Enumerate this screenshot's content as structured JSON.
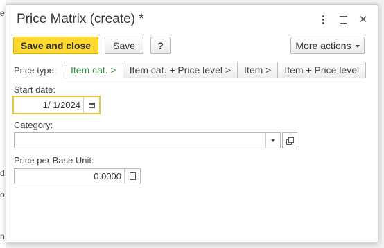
{
  "background": {
    "edge_chars": [
      "e",
      "d",
      "o",
      "n"
    ]
  },
  "dialog": {
    "title": "Price Matrix (create) *",
    "icons": {
      "menu": "kebab-menu-icon",
      "maximize": "maximize-icon",
      "close": "close-icon"
    },
    "close_glyph": "✕"
  },
  "toolbar": {
    "save_close_label": "Save and close",
    "save_label": "Save",
    "help_label": "?",
    "more_actions_label": "More actions"
  },
  "price_type": {
    "label": "Price type:",
    "options": [
      "Item cat. >",
      "Item cat. + Price level >",
      "Item >",
      "Item + Price level"
    ],
    "selected": "Item cat. >"
  },
  "start_date": {
    "label": "Start date:",
    "value": "1/ 1/2024"
  },
  "category": {
    "label": "Category:",
    "value": ""
  },
  "price_per_base_unit": {
    "label": "Price per Base Unit:",
    "value": "0.0000"
  },
  "colors": {
    "primary": "#ffd92f",
    "selected_text": "#2f8c3f",
    "focus_border": "#f0c23a",
    "required_underline": "#d63333"
  }
}
